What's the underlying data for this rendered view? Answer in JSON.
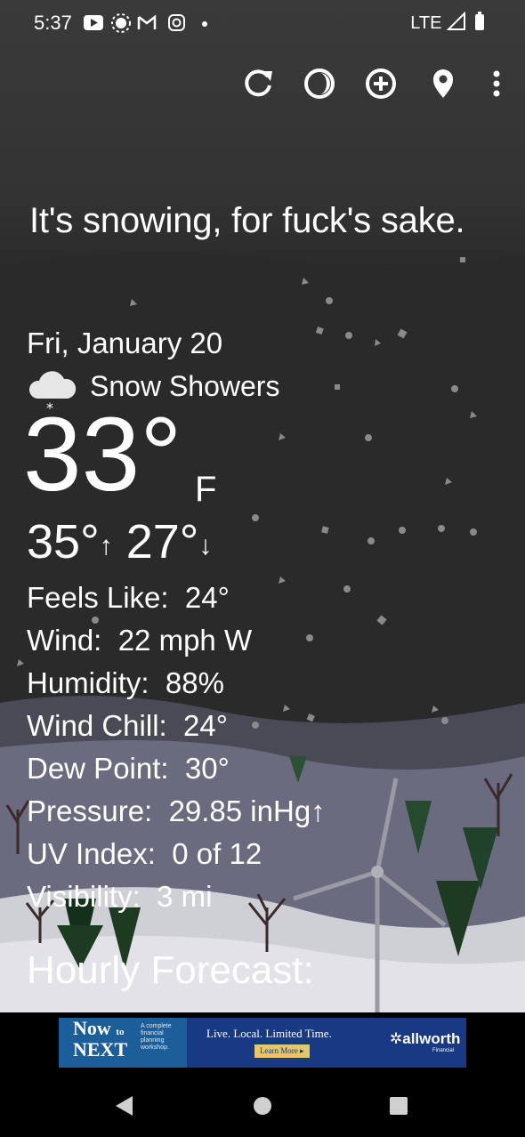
{
  "status_bar": {
    "time": "5:37",
    "network": "LTE",
    "icons": [
      "youtube-icon",
      "settings-sun-icon",
      "gmail-icon",
      "instagram-icon",
      "notification-dot-icon",
      "signal-icon",
      "battery-icon"
    ]
  },
  "toolbar": {
    "icons": [
      "refresh-icon",
      "theme-icon",
      "add-location-icon",
      "location-pin-icon",
      "more-options-icon"
    ]
  },
  "headline": "It's snowing, for fuck's sake.",
  "weather": {
    "date": "Fri, January 20",
    "condition": "Snow Showers",
    "condition_icon": "snow-cloud-icon",
    "temperature": "33°",
    "unit": "F",
    "high": "35°",
    "low": "27°",
    "high_arrow": "↑",
    "low_arrow": "↓"
  },
  "details": [
    {
      "label": "Feels Like:",
      "value": "24°"
    },
    {
      "label": "Wind:",
      "value": "22 mph W"
    },
    {
      "label": "Humidity:",
      "value": "88%"
    },
    {
      "label": "Wind Chill:",
      "value": "24°"
    },
    {
      "label": "Dew Point:",
      "value": "30°"
    },
    {
      "label": "Pressure:",
      "value": "29.85 inHg↑"
    },
    {
      "label": "UV Index:",
      "value": "0 of 12"
    },
    {
      "label": "Visibility:",
      "value": "3 mi"
    }
  ],
  "hourly_title": "Hourly Forecast:",
  "ad": {
    "now": "Now",
    "to": "to",
    "next": "NEXT",
    "small_text": "A complete financial planning workshop.",
    "tagline": "Live. Local. Limited Time.",
    "button": "Learn More",
    "brand": "allworth",
    "brand_sub": "Financial"
  },
  "nav_bar": {
    "icons": [
      "back-icon",
      "home-icon",
      "recents-icon"
    ]
  },
  "colors": {
    "text": "#ffffff",
    "sky": "#333333",
    "snow_ground": "#cfcfd6",
    "ad_blue": "#183a85"
  }
}
